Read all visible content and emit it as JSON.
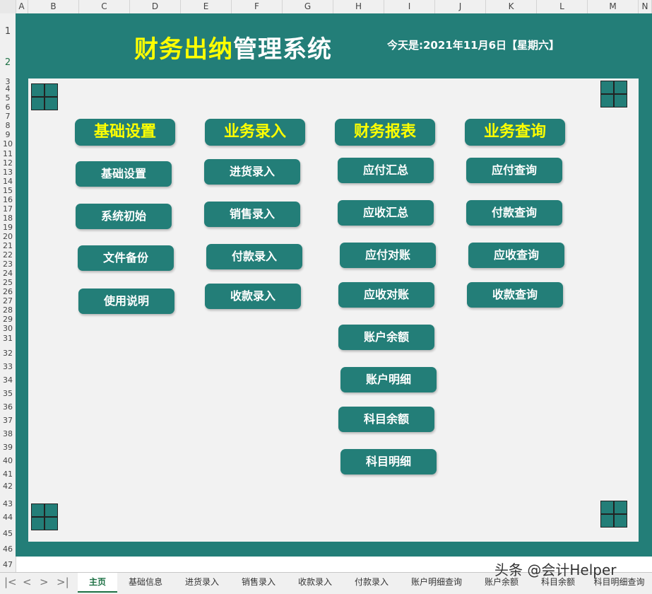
{
  "sheet": {
    "columns": [
      "A",
      "B",
      "C",
      "D",
      "E",
      "F",
      "G",
      "H",
      "I",
      "J",
      "K",
      "L",
      "M",
      "N"
    ],
    "rows": [
      "1",
      "2",
      "3",
      "4",
      "5",
      "6",
      "7",
      "8",
      "9",
      "10",
      "11",
      "12",
      "13",
      "14",
      "15",
      "16",
      "17",
      "18",
      "19",
      "20",
      "21",
      "22",
      "23",
      "24",
      "25",
      "26",
      "27",
      "28",
      "29",
      "30",
      "31",
      "32",
      "33",
      "34",
      "35",
      "36",
      "37",
      "38",
      "39",
      "40",
      "41",
      "42",
      "43",
      "44",
      "45",
      "46",
      "47"
    ]
  },
  "header": {
    "title_highlight": "财务出纳",
    "title_rest": "管理系统",
    "date_text": "今天是:2021年11月6日【星期六】"
  },
  "menu": {
    "groups": [
      {
        "title": "基础设置",
        "items": [
          "基础设置",
          "系统初始",
          "文件备份",
          "使用说明"
        ]
      },
      {
        "title": "业务录入",
        "items": [
          "进货录入",
          "销售录入",
          "付款录入",
          "收款录入"
        ]
      },
      {
        "title": "财务报表",
        "items": [
          "应付汇总",
          "应收汇总",
          "应付对账",
          "应收对账",
          "账户余额",
          "账户明细",
          "科目余额",
          "科目明细"
        ]
      },
      {
        "title": "业务查询",
        "items": [
          "应付查询",
          "付款查询",
          "应收查询",
          "收款查询"
        ]
      }
    ]
  },
  "tabs": {
    "nav": [
      "|<",
      "<",
      ">",
      ">|"
    ],
    "items": [
      "主页",
      "基础信息",
      "进货录入",
      "销售录入",
      "收款录入",
      "付款录入",
      "账户明细查询",
      "账户余额",
      "科目余额",
      "科目明细查询"
    ],
    "active_index": 0
  },
  "watermark": "头条 @会计Helper",
  "colors": {
    "frame": "#237e78",
    "accent_yellow": "#ffff00",
    "canvas": "#f2f2f2"
  }
}
